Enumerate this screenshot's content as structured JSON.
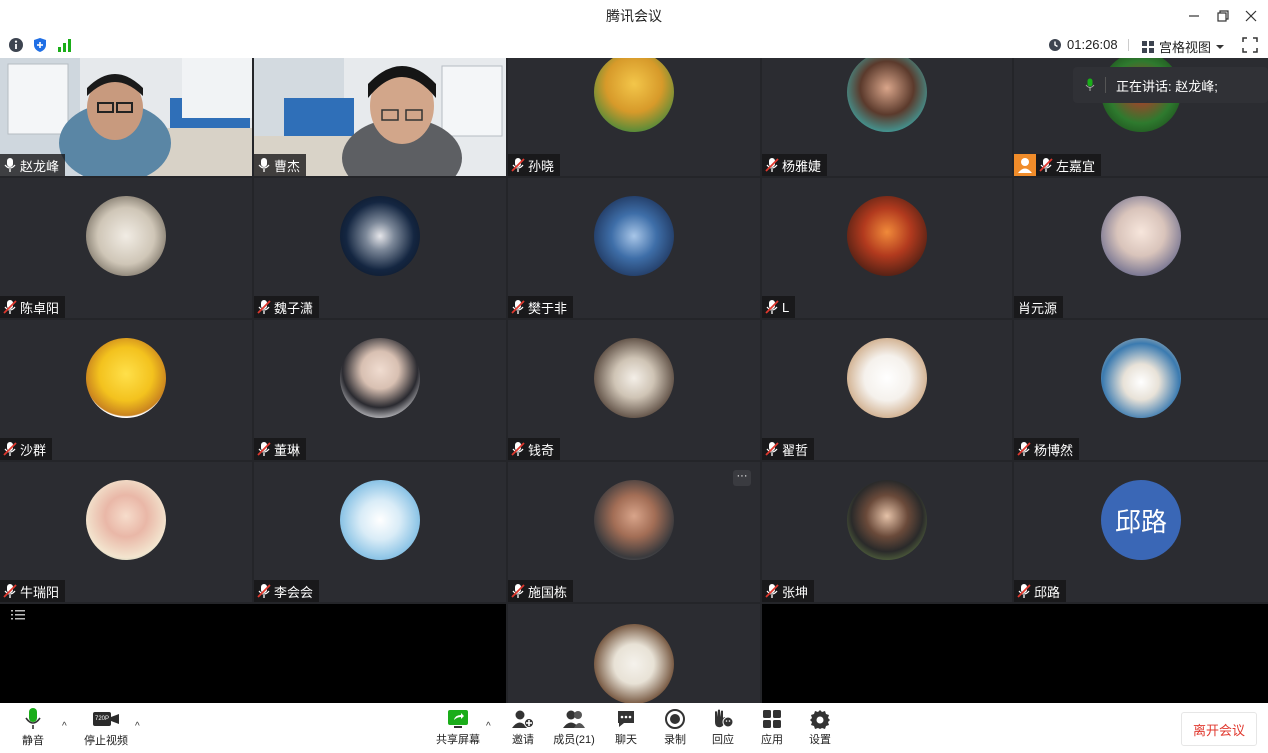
{
  "window": {
    "title": "腾讯会议"
  },
  "infobar": {
    "timer": "01:26:08",
    "view_label": "宫格视图"
  },
  "speaking": {
    "text": "正在讲话:  赵龙峰;"
  },
  "participants": [
    {
      "name": "赵龙峰",
      "muted": false
    },
    {
      "name": "曹杰",
      "muted": false
    },
    {
      "name": "孙晓",
      "muted": true
    },
    {
      "name": "杨雅婕",
      "muted": true
    },
    {
      "name": "左嘉宜",
      "muted": true
    },
    {
      "name": "陈卓阳",
      "muted": true
    },
    {
      "name": "魏子潇",
      "muted": true
    },
    {
      "name": "樊于非",
      "muted": true
    },
    {
      "name": "L",
      "muted": true
    },
    {
      "name": "肖元源",
      "muted": false
    },
    {
      "name": "沙群",
      "muted": true
    },
    {
      "name": "董琳",
      "muted": true
    },
    {
      "name": "钱奇",
      "muted": true
    },
    {
      "name": "翟哲",
      "muted": true
    },
    {
      "name": "杨博然",
      "muted": true
    },
    {
      "name": "牛瑞阳",
      "muted": true
    },
    {
      "name": "李会会",
      "muted": true
    },
    {
      "name": "施国栋",
      "muted": true
    },
    {
      "name": "张坤",
      "muted": true
    },
    {
      "name": "邱路",
      "muted": true
    }
  ],
  "avatar_initials": {
    "qiulu": "邱路"
  },
  "toolbar": {
    "mute": "静音",
    "stop_video": "停止视频",
    "video_badge": "720P",
    "share_screen": "共享屏幕",
    "invite": "邀请",
    "members": "成员(21)",
    "chat": "聊天",
    "record": "录制",
    "reactions": "回应",
    "apps": "应用",
    "settings": "设置",
    "leave": "离开会议"
  },
  "colors": {
    "accent_green": "#1aad19",
    "leave_red": "#e0382e",
    "stage_bg": "#242529",
    "avatar_blue": "#3a67b6"
  }
}
